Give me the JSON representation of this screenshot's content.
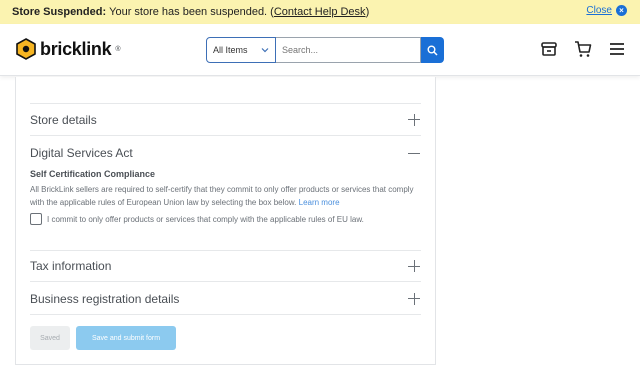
{
  "banner": {
    "label": "Store Suspended:",
    "message": "Your store has been suspended. (",
    "help_link": "Contact Help Desk",
    "message_end": ")",
    "close_label": "Close",
    "bg_color": "#fbf3b0"
  },
  "header": {
    "brand": "bricklink",
    "search": {
      "category_selected": "All Items",
      "placeholder": "Search..."
    },
    "icons": [
      "store-icon",
      "cart-icon",
      "menu-icon"
    ],
    "accent_color": "#1a6fd6"
  },
  "form": {
    "sections": [
      {
        "title": "Store details",
        "state": "collapsed"
      },
      {
        "title": "Digital Services Act",
        "state": "expanded"
      },
      {
        "title": "Tax information",
        "state": "collapsed"
      },
      {
        "title": "Business registration details",
        "state": "collapsed"
      }
    ],
    "dsa": {
      "subtitle": "Self Certification Compliance",
      "description": "All BrickLink sellers are required to self-certify that they commit to only offer products or services that comply with the applicable rules of European Union law by selecting the box below.",
      "learn_more": "Learn more",
      "checkbox_label": "I commit to only offer products or services that comply with the applicable rules of EU law.",
      "checkbox_checked": false
    },
    "buttons": {
      "saved": "Saved",
      "submit": "Save and submit form"
    }
  }
}
